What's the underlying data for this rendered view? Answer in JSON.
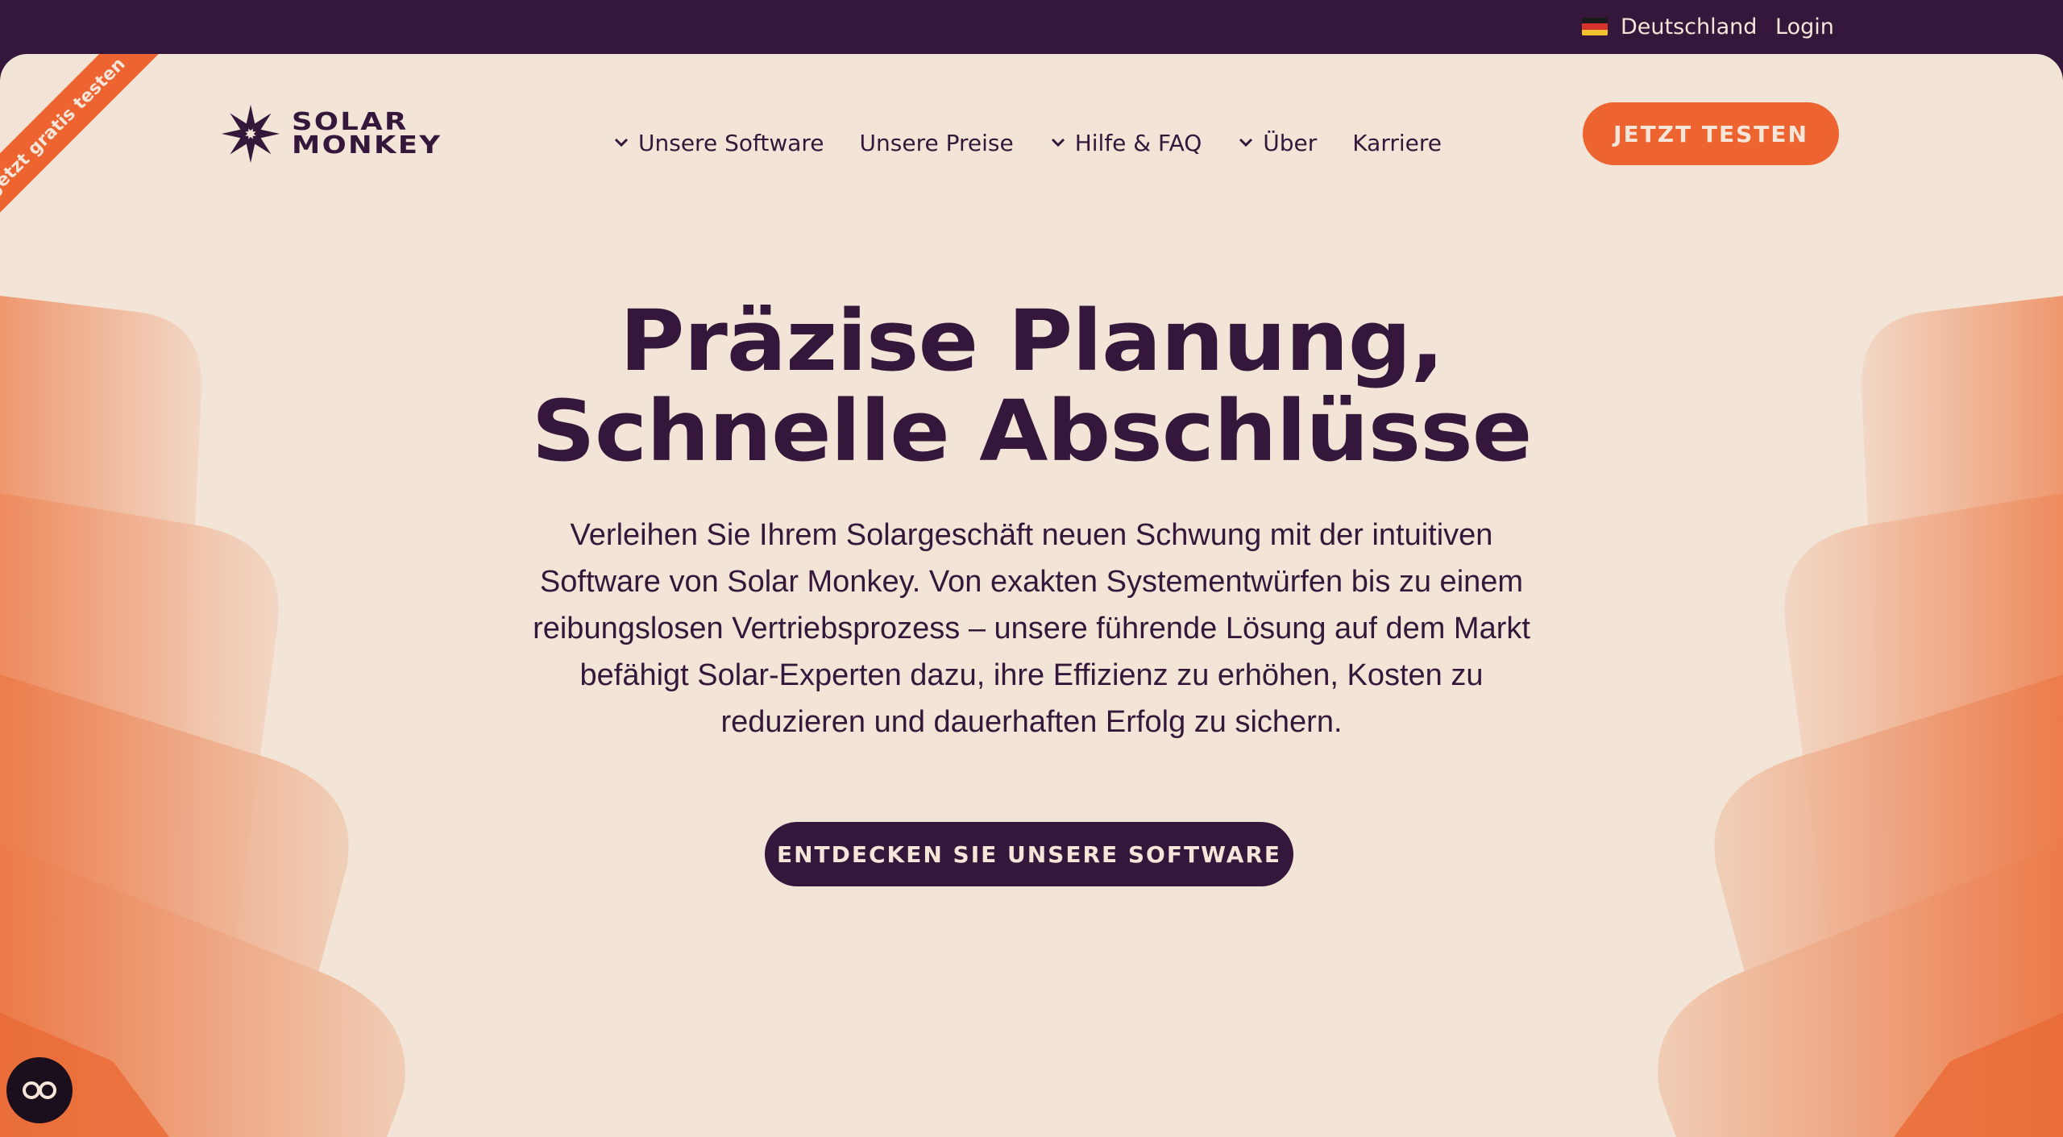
{
  "topbar": {
    "country_label": "Deutschland",
    "country_icon": "germany-flag-icon",
    "login_label": "Login"
  },
  "ribbon": {
    "label": "Jetzt gratis testen"
  },
  "logo": {
    "line1": "SOLAR",
    "line2": "MONKEY",
    "icon": "solar-monkey-star-icon"
  },
  "nav": {
    "items": [
      {
        "label": "Unsere Software",
        "has_dropdown": true
      },
      {
        "label": "Unsere Preise",
        "has_dropdown": false
      },
      {
        "label": "Hilfe & FAQ",
        "has_dropdown": true
      },
      {
        "label": "Über",
        "has_dropdown": true
      },
      {
        "label": "Karriere",
        "has_dropdown": false
      }
    ]
  },
  "header_cta": {
    "label": "JETZT TESTEN"
  },
  "hero": {
    "title_line1": "Präzise Planung,",
    "title_line2": "Schnelle Abschlüsse",
    "subtitle": "Verleihen Sie Ihrem Solargeschäft neuen Schwung mit der intuitiven Software von Solar Monkey. Von exakten Systementwürfen bis zu einem reibungslosen Vertriebsprozess – unsere führende Lösung auf dem Markt befähigt Solar-Experten dazu, ihre Effizienz zu erhöhen, Kosten zu reduzieren und dauerhaften Erfolg zu sichern.",
    "button_label": "ENTDECKEN SIE UNSERE SOFTWARE"
  },
  "accessibility": {
    "icon": "accessibility-glasses-icon"
  },
  "colors": {
    "brand_dark": "#34173a",
    "brand_orange": "#ee6431",
    "background": "#f2e4d6",
    "light_text": "#f6e6da"
  }
}
